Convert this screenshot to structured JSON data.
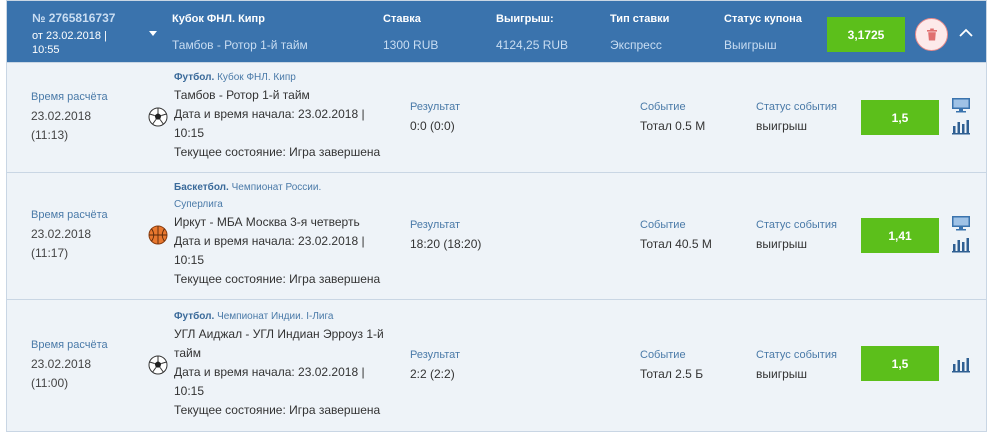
{
  "header": {
    "coupon_id": "№ 2765816737",
    "date_line1": "от 23.02.2018 |",
    "date_line2": "10:55",
    "tournament_label": "Кубок ФНЛ. Кипр",
    "match_value": "Тамбов - Ротор 1-й тайм",
    "stake_label": "Ставка",
    "stake_value": "1300 RUB",
    "win_label": "Выигрыш:",
    "win_value": "4124,25 RUB",
    "bet_type_label": "Тип ставки",
    "bet_type_value": "Экспресс",
    "status_label": "Статус купона",
    "status_value": "Выигрыш",
    "total_odds": "3,1725"
  },
  "rows": [
    {
      "calc_label": "Время расчёта",
      "calc_date": "23.02.2018",
      "calc_time": "(11:13)",
      "sport": "Футбол.",
      "league": "Кубок ФНЛ. Кипр",
      "league_cont": "",
      "sport_icon": "football-icon",
      "match": "Тамбов - Ротор 1-й тайм",
      "match_cont": "",
      "start_line1": "Дата и время начала: 23.02.2018 |",
      "start_line2": "10:15",
      "state": "Текущее состояние: Игра завершена",
      "result_label": "Результат",
      "result_value": "0:0 (0:0)",
      "event_label": "Событие",
      "event_value": "Тотал 0.5 М",
      "event_status_label": "Статус события",
      "event_status_value": "выигрыш",
      "odds": "1,5"
    },
    {
      "calc_label": "Время расчёта",
      "calc_date": "23.02.2018",
      "calc_time": "(11:17)",
      "sport": "Баскетбол.",
      "league": "Чемпионат России.",
      "league_cont": "Суперлига",
      "sport_icon": "basketball-icon",
      "match": "Иркут - МБА Москва 3-я четверть",
      "match_cont": "",
      "start_line1": "Дата и время начала: 23.02.2018 |",
      "start_line2": "10:15",
      "state": "Текущее состояние: Игра завершена",
      "result_label": "Результат",
      "result_value": "18:20 (18:20)",
      "event_label": "Событие",
      "event_value": "Тотал 40.5 М",
      "event_status_label": "Статус события",
      "event_status_value": "выигрыш",
      "odds": "1,41"
    },
    {
      "calc_label": "Время расчёта",
      "calc_date": "23.02.2018",
      "calc_time": "(11:00)",
      "sport": "Футбол.",
      "league": "Чемпионат Индии. I-Лига",
      "league_cont": "",
      "sport_icon": "football-icon",
      "match": "УГЛ Аиджал - УГЛ Индиан Эрроуз 1-й",
      "match_cont": "тайм",
      "start_line1": "Дата и время начала: 23.02.2018 |",
      "start_line2": "10:15",
      "state": "Текущее состояние: Игра завершена",
      "result_label": "Результат",
      "result_value": "2:2 (2:2)",
      "event_label": "Событие",
      "event_value": "Тотал 2.5 Б",
      "event_status_label": "Статус события",
      "event_status_value": "выигрыш",
      "odds": "1,5"
    }
  ]
}
